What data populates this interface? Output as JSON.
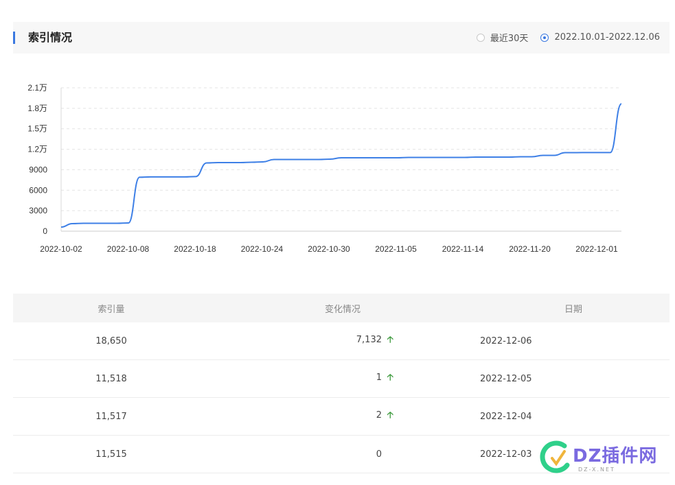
{
  "header": {
    "title": "索引情况",
    "range_options": [
      {
        "label": "最近30天",
        "checked": false
      },
      {
        "label": "2022.10.01-2022.12.06",
        "checked": true
      }
    ]
  },
  "colors": {
    "accent": "#3a78e0",
    "line": "#3d7fe6",
    "up_arrow": "#3d9a3d"
  },
  "chart_data": {
    "type": "line",
    "title": "",
    "xlabel": "",
    "ylabel": "",
    "ylim": [
      0,
      21000
    ],
    "y_ticks": [
      0,
      3000,
      6000,
      9000,
      12000,
      15000,
      18000,
      21000
    ],
    "y_tick_labels": [
      "0",
      "3000",
      "6000",
      "9000",
      "1.2万",
      "1.5万",
      "1.8万",
      "2.1万"
    ],
    "x_tick_labels": [
      "2022-10-02",
      "2022-10-08",
      "2022-10-18",
      "2022-10-24",
      "2022-10-30",
      "2022-11-05",
      "2022-11-14",
      "2022-11-20",
      "2022-12-01"
    ],
    "grid": true,
    "series": [
      {
        "values": [
          600,
          1100,
          1150,
          1150,
          1150,
          1150,
          1200,
          7900,
          7950,
          7950,
          7950,
          7950,
          8000,
          10000,
          10050,
          10050,
          10050,
          10100,
          10150,
          10500,
          10500,
          10500,
          10500,
          10500,
          10550,
          10750,
          10750,
          10750,
          10750,
          10750,
          10750,
          10800,
          10800,
          10800,
          10800,
          10800,
          10800,
          10850,
          10850,
          10850,
          10850,
          10900,
          10900,
          11100,
          11100,
          11500,
          11510,
          11515,
          11517,
          11518,
          18650
        ]
      }
    ]
  },
  "table": {
    "headers": [
      "索引量",
      "变化情况",
      "日期"
    ],
    "rows": [
      {
        "count": "18,650",
        "change": "7,132",
        "up": true,
        "date": "2022-12-06"
      },
      {
        "count": "11,518",
        "change": "1",
        "up": true,
        "date": "2022-12-05"
      },
      {
        "count": "11,517",
        "change": "2",
        "up": true,
        "date": "2022-12-04"
      },
      {
        "count": "11,515",
        "change": "0",
        "up": false,
        "date": "2022-12-03"
      }
    ]
  },
  "watermark": {
    "text": "DZ插件网",
    "sub": "DZ-X.NET"
  }
}
